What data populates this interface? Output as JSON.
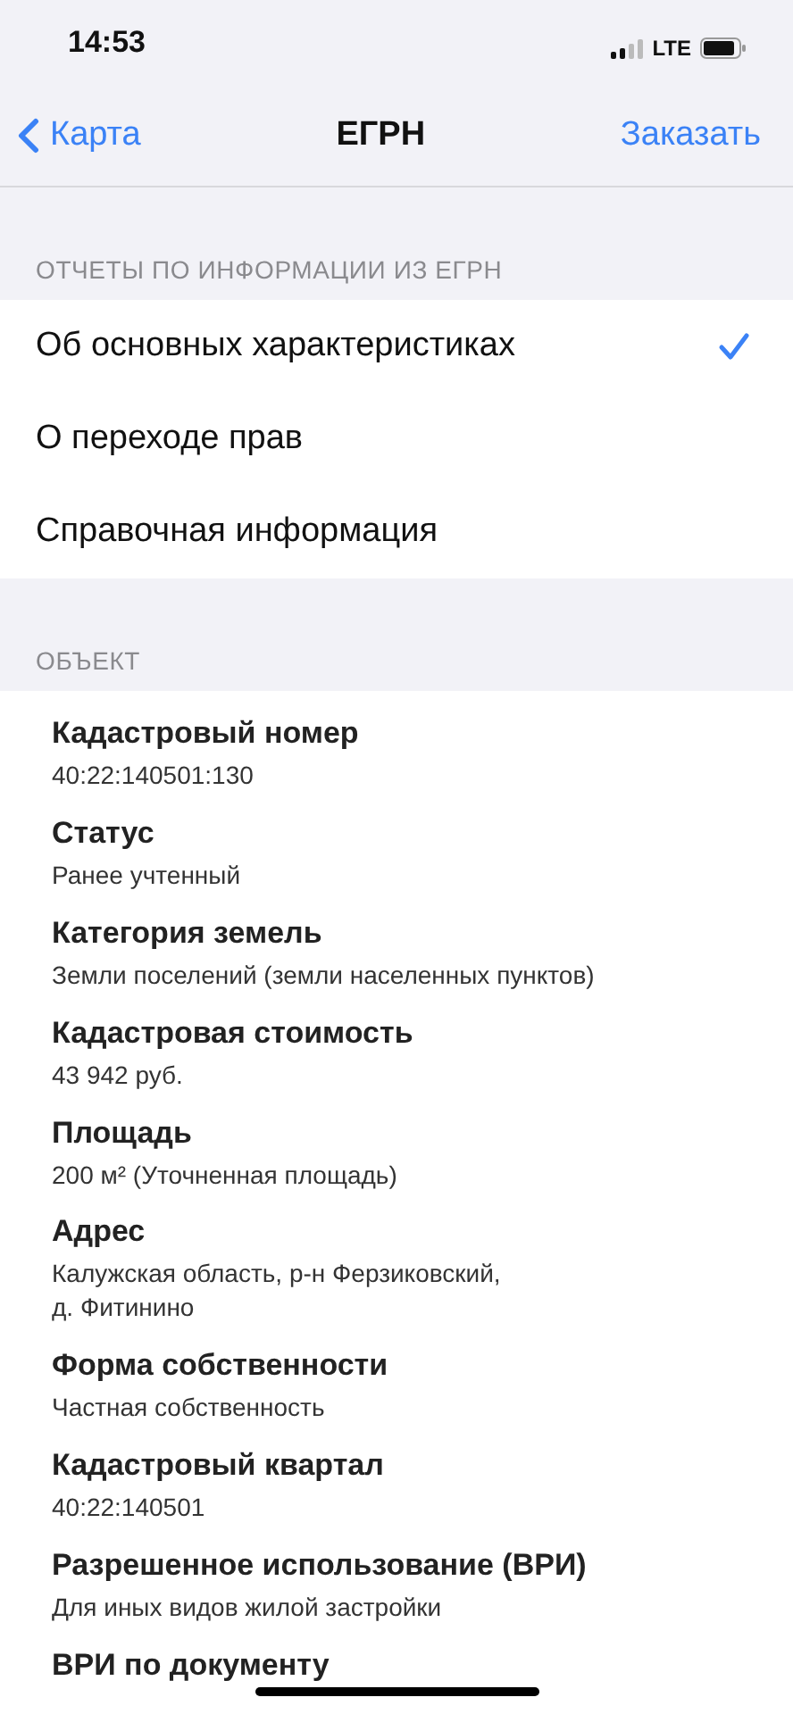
{
  "status_bar": {
    "time": "14:53",
    "network": "LTE"
  },
  "nav": {
    "back": "Карта",
    "title": "ЕГРН",
    "action": "Заказать"
  },
  "reports": {
    "header": "ОТЧЕТЫ ПО ИНФОРМАЦИИ ИЗ ЕГРН",
    "options": [
      {
        "label": "Об основных характеристиках",
        "selected": true
      },
      {
        "label": "О переходе прав",
        "selected": false
      },
      {
        "label": "Справочная информация",
        "selected": false
      }
    ]
  },
  "object": {
    "header": "ОБЪЕКТ",
    "fields": [
      {
        "label": "Кадастровый номер",
        "value": "40:22:140501:130"
      },
      {
        "label": "Статус",
        "value": "Ранее учтенный"
      },
      {
        "label": "Категория земель",
        "value": "Земли поселений (земли населенных пунктов)"
      },
      {
        "label": "Кадастровая стоимость",
        "value": "43 942 руб."
      },
      {
        "label": "Площадь",
        "value": "200 м² (Уточненная площадь)"
      },
      {
        "label": "Адрес",
        "value": "Калужская область, р-н Ферзиковский,\nд. Фитинино"
      },
      {
        "label": "Форма собственности",
        "value": "Частная собственность"
      },
      {
        "label": "Кадастровый квартал",
        "value": "40:22:140501"
      },
      {
        "label": "Разрешенное использование (ВРИ)",
        "value": "Для иных видов жилой застройки"
      },
      {
        "label": "ВРИ по документу"
      }
    ]
  }
}
